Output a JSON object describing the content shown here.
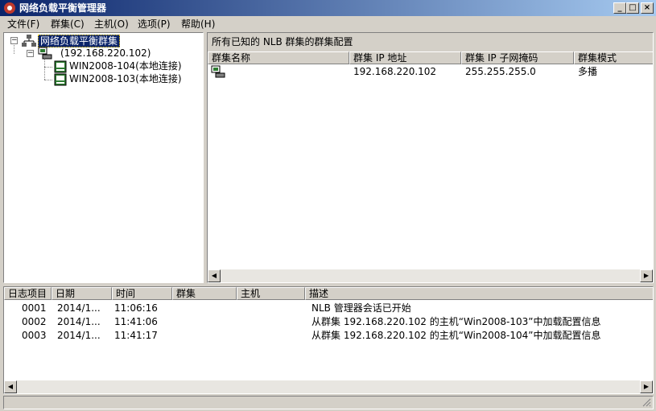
{
  "window": {
    "title": "网络负载平衡管理器"
  },
  "menu": [
    "文件(F)",
    "群集(C)",
    "主机(O)",
    "选项(P)",
    "帮助(H)"
  ],
  "tree": {
    "root_label": "网络负载平衡群集",
    "cluster_label": "(192.168.220.102)",
    "hosts": [
      "WIN2008-104(本地连接)",
      "WIN2008-103(本地连接)"
    ]
  },
  "right_panel": {
    "header": "所有已知的 NLB 群集的群集配置",
    "columns": [
      "群集名称",
      "群集 IP 地址",
      "群集 IP 子网掩码",
      "群集模式"
    ],
    "rows": [
      {
        "name": "",
        "ip": "192.168.220.102",
        "mask": "255.255.255.0",
        "mode": "多播"
      }
    ]
  },
  "log_panel": {
    "columns": [
      "日志项目",
      "日期",
      "时间",
      "群集",
      "主机",
      "描述"
    ],
    "rows": [
      {
        "id": "0001",
        "date": "2014/1...",
        "time": "11:06:16",
        "cluster": "",
        "host": "",
        "desc": "NLB 管理器会话已开始"
      },
      {
        "id": "0002",
        "date": "2014/1...",
        "time": "11:41:06",
        "cluster": "",
        "host": "",
        "desc": "从群集 192.168.220.102 的主机“Win2008-103”中加载配置信息"
      },
      {
        "id": "0003",
        "date": "2014/1...",
        "time": "11:41:17",
        "cluster": "",
        "host": "",
        "desc": "从群集 192.168.220.102 的主机“Win2008-104”中加载配置信息"
      }
    ]
  },
  "window_buttons": {
    "minimize": "_",
    "maximize": "□",
    "close": "×"
  },
  "scroll_glyphs": {
    "left": "◀",
    "right": "▶"
  }
}
